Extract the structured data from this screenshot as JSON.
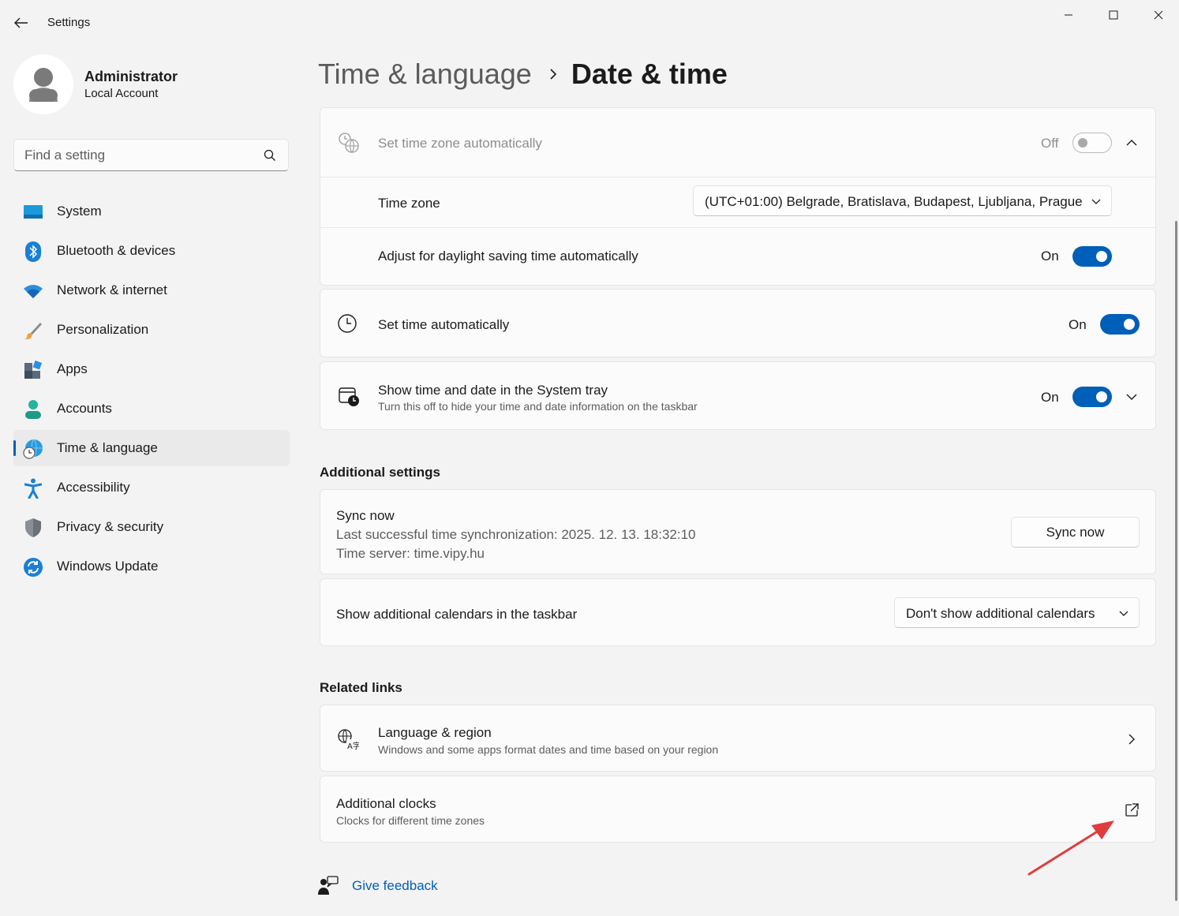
{
  "window": {
    "title": "Settings",
    "back_icon": "back-arrow-icon",
    "minimize_icon": "minimize-icon",
    "maximize_icon": "maximize-icon",
    "close_icon": "close-icon"
  },
  "profile": {
    "name": "Administrator",
    "account_type": "Local Account"
  },
  "search": {
    "placeholder": "Find a setting",
    "value": ""
  },
  "sidebar": {
    "items": [
      {
        "label": "System",
        "icon": "system-icon",
        "active": false
      },
      {
        "label": "Bluetooth & devices",
        "icon": "bluetooth-icon",
        "active": false
      },
      {
        "label": "Network & internet",
        "icon": "wifi-icon",
        "active": false
      },
      {
        "label": "Personalization",
        "icon": "brush-icon",
        "active": false
      },
      {
        "label": "Apps",
        "icon": "apps-icon",
        "active": false
      },
      {
        "label": "Accounts",
        "icon": "accounts-icon",
        "active": false
      },
      {
        "label": "Time & language",
        "icon": "globe-clock-icon",
        "active": true
      },
      {
        "label": "Accessibility",
        "icon": "accessibility-icon",
        "active": false
      },
      {
        "label": "Privacy & security",
        "icon": "shield-icon",
        "active": false
      },
      {
        "label": "Windows Update",
        "icon": "update-icon",
        "active": false
      }
    ]
  },
  "breadcrumb": {
    "parent": "Time & language",
    "current": "Date & time"
  },
  "timezone_card": {
    "auto_label": "Set time zone automatically",
    "auto_state": "Off",
    "auto_on": false,
    "timezone_label": "Time zone",
    "timezone_value": "(UTC+01:00) Belgrade, Bratislava, Budapest, Ljubljana, Prague",
    "dst_label": "Adjust for daylight saving time automatically",
    "dst_state": "On",
    "dst_on": true
  },
  "set_time_card": {
    "label": "Set time automatically",
    "state": "On",
    "on": true
  },
  "systray_card": {
    "label": "Show time and date in the System tray",
    "description": "Turn this off to hide your time and date information on the taskbar",
    "state": "On",
    "on": true
  },
  "additional_settings": {
    "heading": "Additional settings",
    "sync": {
      "title": "Sync now",
      "last_sync": "Last successful time synchronization: 2025. 12. 13. 18:32:10",
      "server": "Time server: time.vipy.hu",
      "button": "Sync now"
    },
    "calendars": {
      "label": "Show additional calendars in the taskbar",
      "value": "Don't show additional calendars"
    }
  },
  "related_links": {
    "heading": "Related links",
    "language_region": {
      "title": "Language & region",
      "description": "Windows and some apps format dates and time based on your region"
    },
    "additional_clocks": {
      "title": "Additional clocks",
      "description": "Clocks for different time zones"
    }
  },
  "feedback": {
    "label": "Give feedback"
  },
  "colors": {
    "accent": "#005fb8",
    "annotation_arrow": "#e03c3c"
  }
}
